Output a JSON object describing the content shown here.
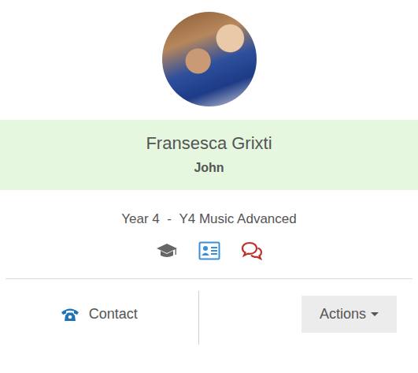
{
  "student": {
    "name": "Fransesca Grixti",
    "preferred_name": "John"
  },
  "class_info": {
    "year": "Year 4",
    "separator": "-",
    "group": "Y4 Music Advanced"
  },
  "contact": {
    "label": "Contact"
  },
  "actions": {
    "label": "Actions"
  }
}
